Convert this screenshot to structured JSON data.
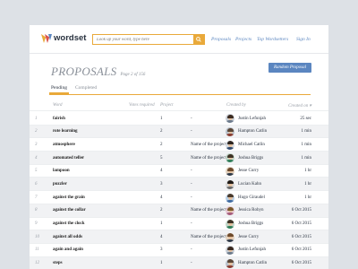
{
  "app": {
    "logo_text": "wordset",
    "accent": "#e9a93a",
    "link": "#5b86c0"
  },
  "search": {
    "placeholder": "Look up your word, type here"
  },
  "nav": {
    "proposals": "Proposals",
    "projects": "Projects",
    "top_wordsetters": "Top Wordsetters",
    "sign_in": "Sign In"
  },
  "page": {
    "title": "PROPOSALS",
    "page_info": "Page 2 of 156",
    "random_button": "Random Proposal"
  },
  "tabs": {
    "pending": "Pending",
    "completed": "Completed"
  },
  "columns": {
    "word": "Word",
    "votes": "Votes required",
    "project": "Project",
    "created_by": "Created by",
    "created_on": "Created on ▾"
  },
  "rows": [
    {
      "num": "1",
      "word": "fairish",
      "votes": "1",
      "project": "-",
      "user": "Justin Lefunjah",
      "created": "25 sec",
      "avatar": "a1"
    },
    {
      "num": "2",
      "word": "rote learning",
      "votes": "2",
      "project": "-",
      "user": "Hampton Catlin",
      "created": "1 min",
      "avatar": "a2"
    },
    {
      "num": "3",
      "word": "atmosphere",
      "votes": "2",
      "project": "Name of the project",
      "user": "Michael Catlin",
      "created": "1 min",
      "avatar": "a3"
    },
    {
      "num": "4",
      "word": "automated teller",
      "votes": "5",
      "project": "Name of the project",
      "user": "Joshua Briggs",
      "created": "1 min",
      "avatar": "a4"
    },
    {
      "num": "5",
      "word": "lampoon",
      "votes": "4",
      "project": "-",
      "user": "Jesse Curry",
      "created": "1 hr",
      "avatar": "a5"
    },
    {
      "num": "6",
      "word": "puzzler",
      "votes": "3",
      "project": "-",
      "user": "Lucian Kahn",
      "created": "1 hr",
      "avatar": "a6"
    },
    {
      "num": "7",
      "word": "against the grain",
      "votes": "4",
      "project": "-",
      "user": "Hugo Giraudel",
      "created": "1 hr",
      "avatar": "a7"
    },
    {
      "num": "8",
      "word": "against the collar",
      "votes": "2",
      "project": "Name of the project",
      "user": "Jessica Robyn",
      "created": "6 Oct 2015",
      "avatar": "a8"
    },
    {
      "num": "9",
      "word": "against the clock",
      "votes": "1",
      "project": "-",
      "user": "Joshua Briggs",
      "created": "6 Oct 2015",
      "avatar": "a4"
    },
    {
      "num": "10",
      "word": "against all odds",
      "votes": "4",
      "project": "Name of the project",
      "user": "Jesse Curry",
      "created": "6 Oct 2015",
      "avatar": "a5"
    },
    {
      "num": "11",
      "word": "again and again",
      "votes": "3",
      "project": "-",
      "user": "Justin Lefunjah",
      "created": "6 Oct 2015",
      "avatar": "a1"
    },
    {
      "num": "12",
      "word": "steps",
      "votes": "1",
      "project": "-",
      "user": "Hampton Catlin",
      "created": "6 Oct 2015",
      "avatar": "a2"
    }
  ]
}
